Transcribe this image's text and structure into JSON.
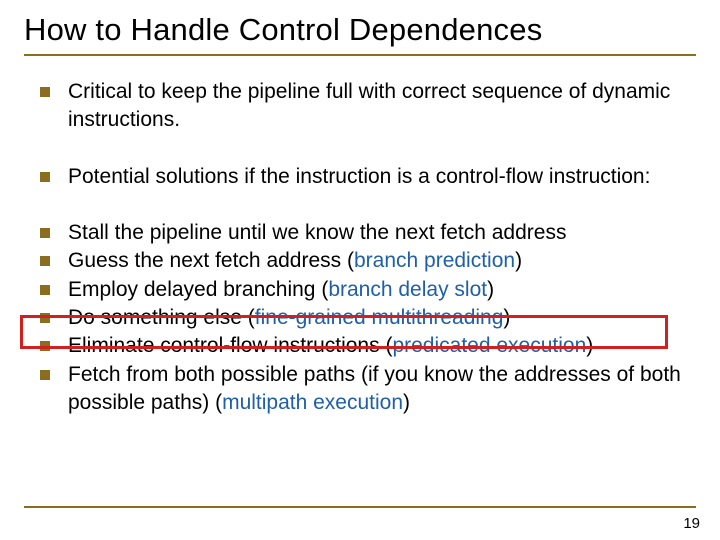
{
  "title": "How to Handle Control Dependences",
  "intro": [
    "Critical to keep the pipeline full with correct sequence of dynamic instructions.",
    "Potential solutions if the instruction is a control-flow instruction:"
  ],
  "solutions": {
    "s0": "Stall the pipeline until we know the next fetch address",
    "s1_pre": "Guess the next fetch address (",
    "s1_term": "branch prediction",
    "s1_post": ")",
    "s2_pre": "Employ delayed branching (",
    "s2_term": "branch delay slot",
    "s2_post": ")",
    "s3_pre": "Do something else (",
    "s3_term": "fine-grained multithreading",
    "s3_post": ")",
    "s4_pre": "Eliminate control-flow instructions (",
    "s4_term": "predicated execution",
    "s4_post": ")",
    "s5_pre": "Fetch from both possible paths (if you know the addresses of both possible paths) (",
    "s5_term": "multipath execution",
    "s5_post": ")"
  },
  "page_number": "19"
}
